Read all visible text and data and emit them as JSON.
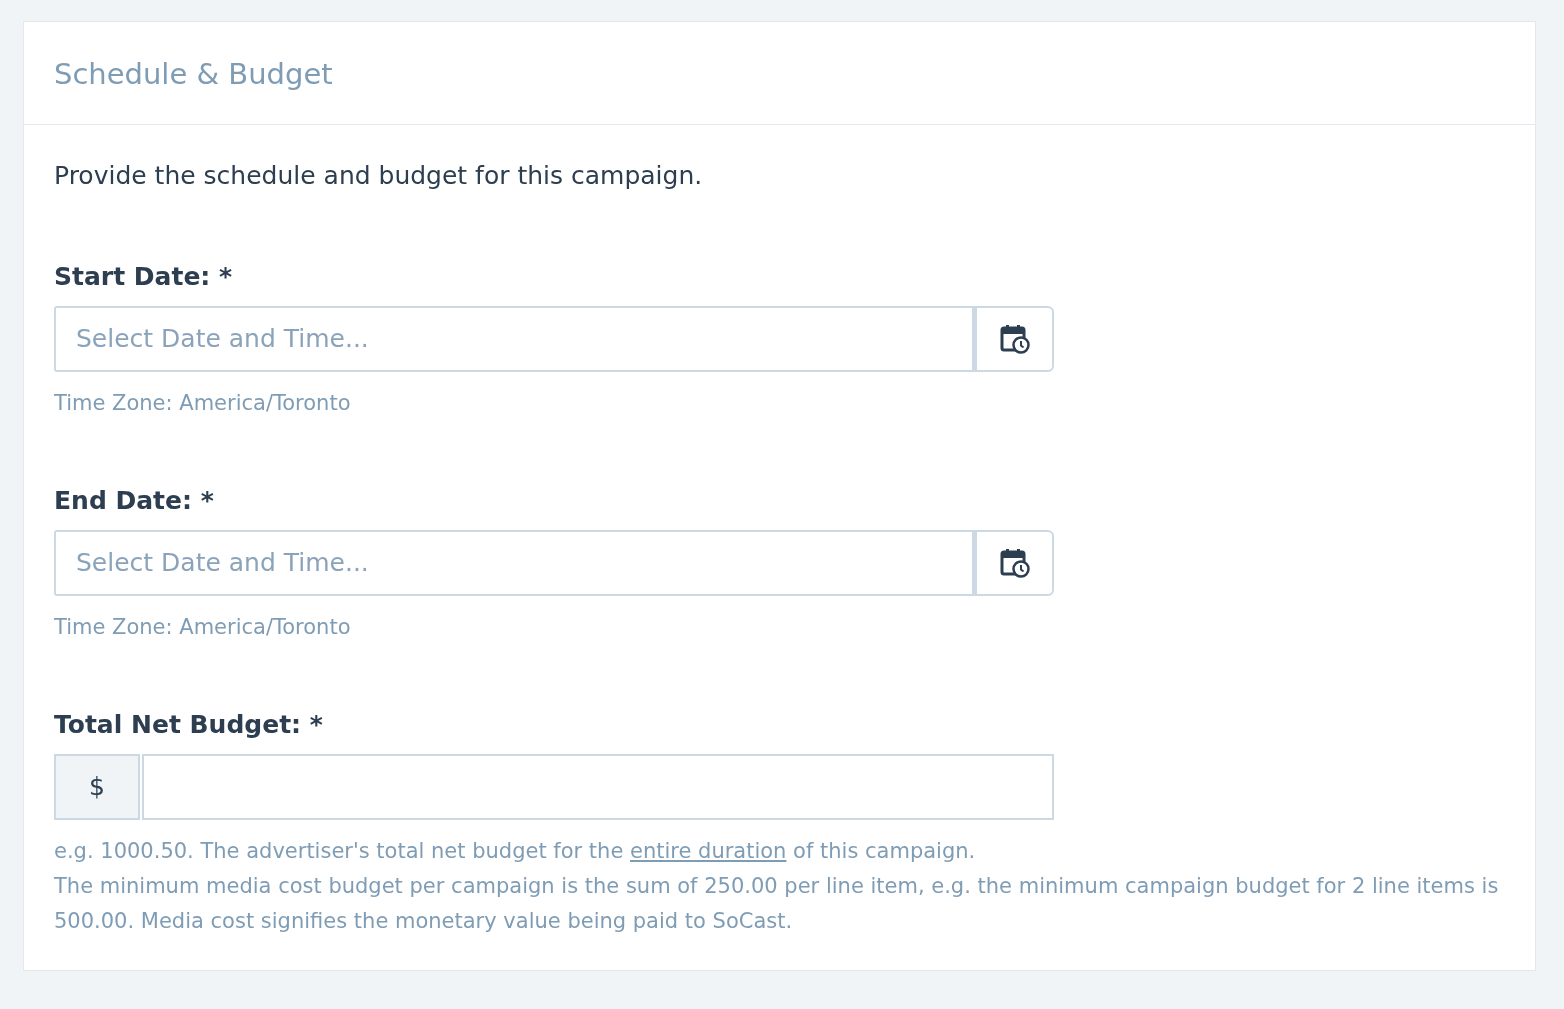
{
  "card": {
    "title": "Schedule & Budget",
    "intro": "Provide the schedule and budget for this campaign."
  },
  "fields": [
    {
      "kind": "datetime",
      "label": "Start Date: *",
      "placeholder": "Select Date and Time...",
      "hint": "Time Zone: America/Toronto"
    },
    {
      "kind": "datetime",
      "label": "End Date: *",
      "placeholder": "Select Date and Time...",
      "hint": "Time Zone: America/Toronto"
    },
    {
      "kind": "money",
      "label": "Total Net Budget: *",
      "prefix": "$",
      "hint_parts": [
        {
          "text": "e.g. 1000.50. The advertiser's total net budget for the ",
          "underline": false
        },
        {
          "text": "entire duration",
          "underline": true
        },
        {
          "text": " of this campaign.",
          "underline": false
        }
      ],
      "note": "The minimum media cost budget per campaign is the sum of 250.00 per line item, e.g. the minimum campaign budget for 2 line items is 500.00. Media cost signifies the monetary value being paid to SoCast."
    }
  ]
}
